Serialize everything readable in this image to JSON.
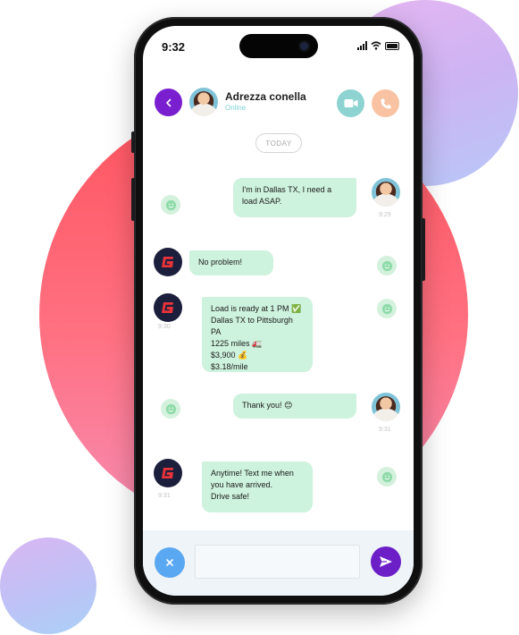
{
  "status_bar": {
    "time": "9:32"
  },
  "header": {
    "contact_name": "Adrezza conella",
    "contact_status": "Online"
  },
  "date_divider": "TODAY",
  "messages": [
    {
      "direction": "outgoing",
      "text": "I'm in Dallas TX, I need a\nload ASAP.",
      "time": "9:29"
    },
    {
      "direction": "incoming",
      "text": "No problem!",
      "time": ""
    },
    {
      "direction": "incoming",
      "text": "Load is ready at 1 PM ✅\nDallas TX to Pittsburgh PA\n1225 miles 🚛\n$3,900 💰\n$3.18/mile",
      "time": "9:30"
    },
    {
      "direction": "outgoing",
      "text": "Thank you! 😊",
      "time": "9:31"
    },
    {
      "direction": "incoming",
      "text": "Anytime! Text me when\nyou have arrived.\nDrive safe!",
      "time": "9:31"
    }
  ],
  "composer": {
    "placeholder": ""
  },
  "colors": {
    "accent_purple": "#7a1fcf",
    "bubble_green": "#cdf2dd",
    "video_teal": "#8dd3d1",
    "call_peach": "#f9c3a3",
    "close_blue": "#5ba8f2",
    "brand_navy": "#1b1f3b",
    "brand_red": "#e8333a"
  },
  "icons": {
    "back": "chevron-left-icon",
    "video": "video-camera-icon",
    "call": "phone-icon",
    "reaction": "smile-icon",
    "brand": "g-logo-icon",
    "close": "close-icon",
    "send": "send-icon"
  }
}
